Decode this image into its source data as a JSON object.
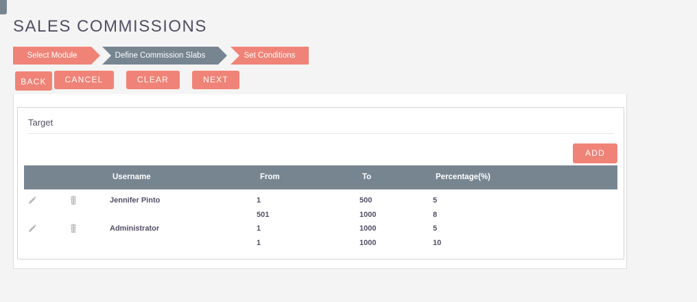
{
  "page": {
    "title": "SALES COMMISSIONS"
  },
  "wizard": {
    "steps": [
      {
        "label": "Select Module"
      },
      {
        "label": "Define Commission Slabs"
      },
      {
        "label": "Set Conditions"
      }
    ]
  },
  "toolbar": {
    "back_label": "BACK",
    "cancel_label": "CANCEL",
    "clear_label": "CLEAR",
    "next_label": "NEXT"
  },
  "target": {
    "title": "Target",
    "add_label": "ADD",
    "columns": {
      "username": "Username",
      "from": "From",
      "to": "To",
      "percentage": "Percentage(%)"
    },
    "rows": [
      {
        "username": "Jennifer Pinto",
        "from": "1",
        "to": "500",
        "percentage": "5"
      },
      {
        "username": "",
        "from": "501",
        "to": "1000",
        "percentage": "8"
      },
      {
        "username": "Administrator",
        "from": "1",
        "to": "1000",
        "percentage": "5"
      },
      {
        "username": "",
        "from": "1",
        "to": "1000",
        "percentage": "10"
      }
    ]
  },
  "colors": {
    "accent": "#f08377",
    "header": "#778591",
    "text": "#534d64",
    "icon": "#b8b8b8"
  }
}
